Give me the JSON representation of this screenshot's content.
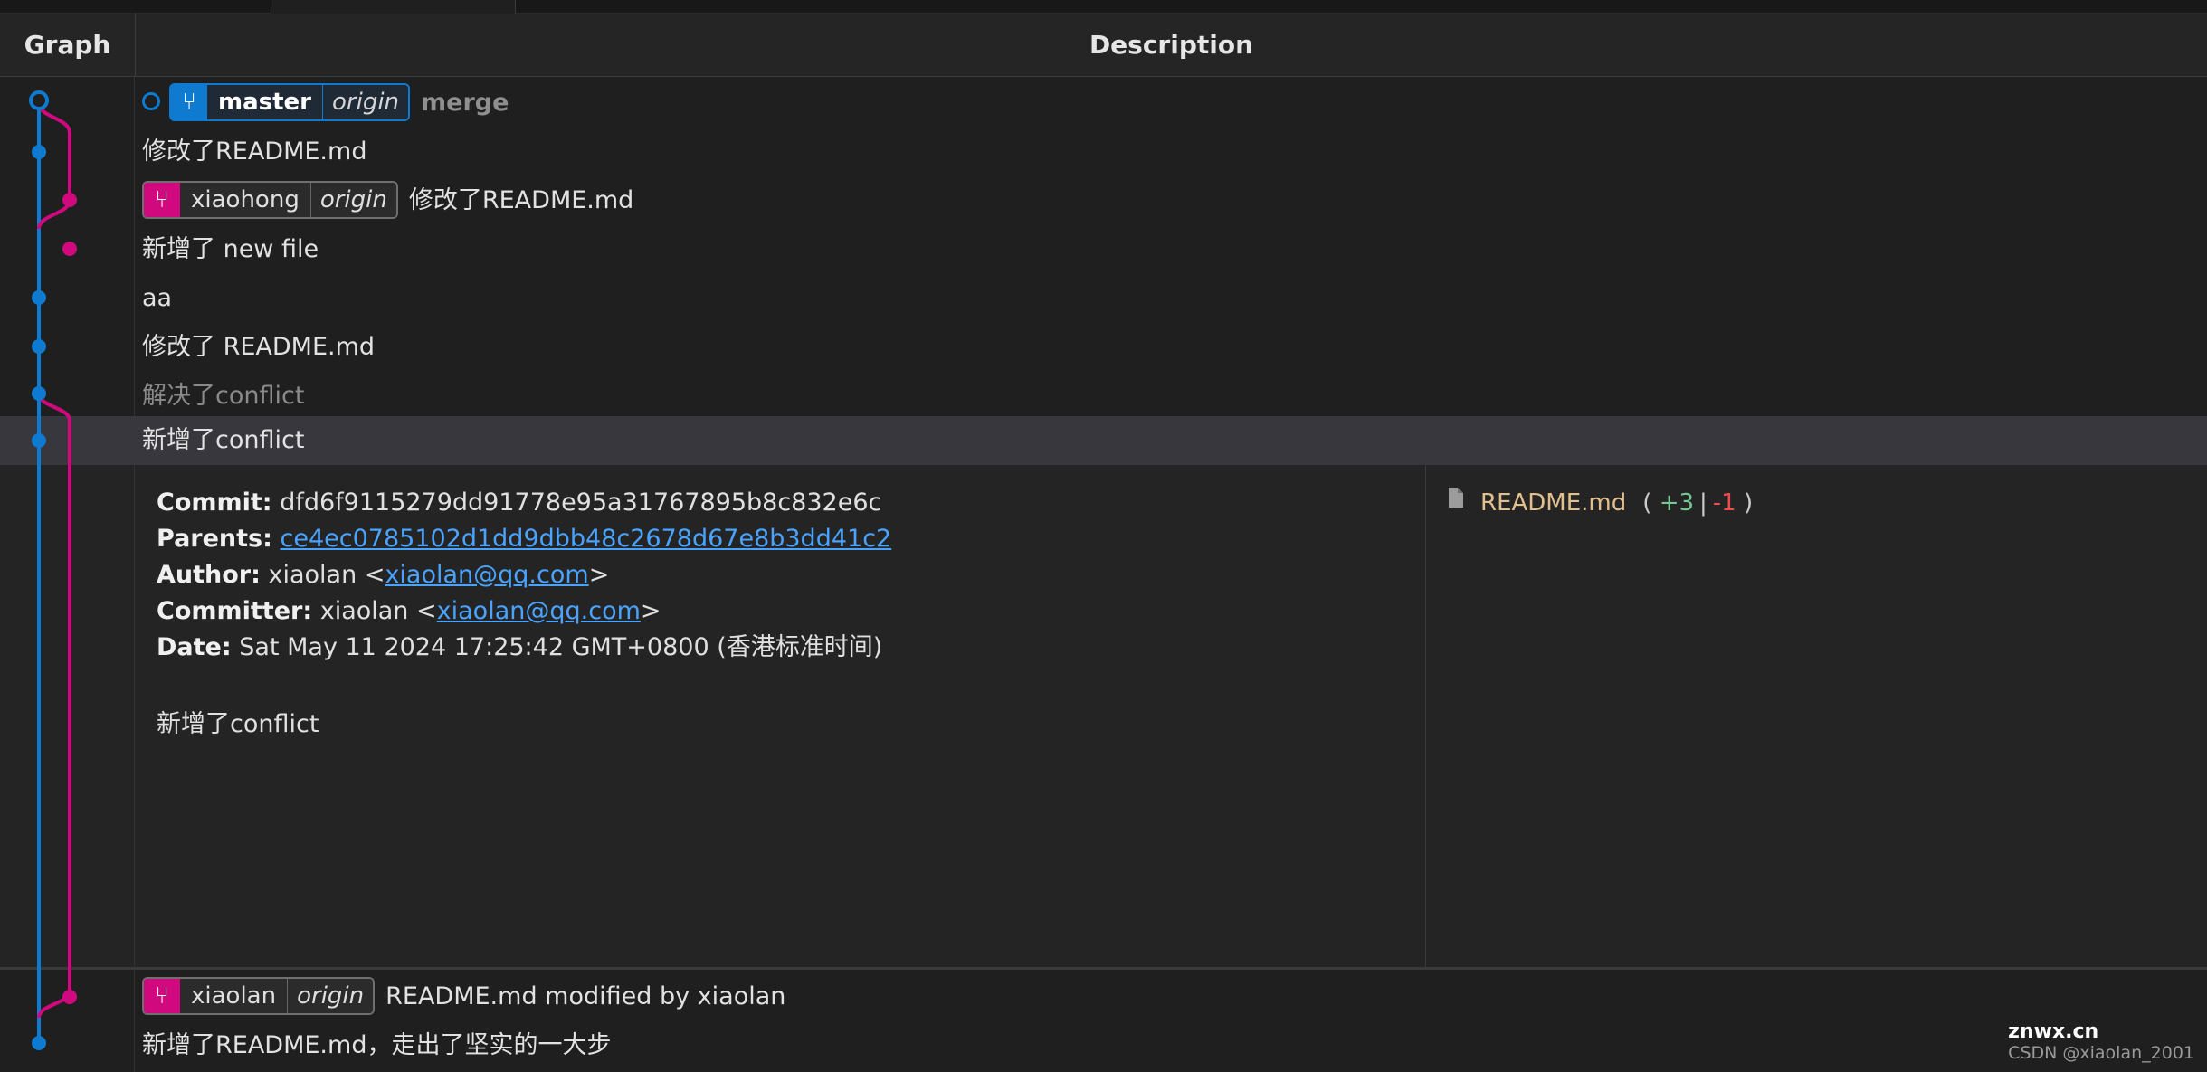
{
  "header": {
    "graph": "Graph",
    "description": "Description"
  },
  "colors": {
    "blue": "#0e7bd1",
    "pink": "#d1097f",
    "link": "#4aa3ff",
    "file": "#e2c08d",
    "add": "#73c991",
    "del": "#f14c4c"
  },
  "rows": [
    {
      "badge": {
        "name": "master",
        "remote": "origin",
        "color": "blue",
        "icon": "branch-icon"
      },
      "message": "merge",
      "style": "grey"
    },
    {
      "message": "修改了README.md"
    },
    {
      "badge": {
        "name": "xiaohong",
        "remote": "origin",
        "color": "pink",
        "icon": "branch-icon"
      },
      "message": "修改了README.md"
    },
    {
      "message": "新增了 new file"
    },
    {
      "message": "aa"
    },
    {
      "message": "修改了 README.md"
    },
    {
      "message": "解决了conflict",
      "style": "dim"
    },
    {
      "message": "新增了conflict",
      "selected": true
    },
    {
      "badge": {
        "name": "xiaolan",
        "remote": "origin",
        "color": "pink",
        "icon": "branch-icon"
      },
      "message": "README.md modified by xiaolan"
    },
    {
      "message": "新增了README.md，走出了坚实的一大步"
    }
  ],
  "details": {
    "commit_label": "Commit:",
    "commit": "dfd6f9115279dd91778e95a31767895b8c832e6c",
    "parents_label": "Parents:",
    "parents": "ce4ec0785102d1dd9dbb48c2678d67e8b3dd41c2",
    "author_label": "Author:",
    "author_name": "xiaolan",
    "author_email": "xiaolan@qq.com",
    "committer_label": "Committer:",
    "committer_name": "xiaolan",
    "committer_email": "xiaolan@qq.com",
    "date_label": "Date:",
    "date": "Sat May 11 2024 17:25:42 GMT+0800 (香港标准时间)",
    "message": "新增了conflict",
    "files": [
      {
        "name": "README.md",
        "additions": "+3",
        "deletions": "-1",
        "icon": "file-icon"
      }
    ]
  },
  "watermark": {
    "site": "znwx.cn",
    "author": "CSDN @xiaolan_2001"
  }
}
